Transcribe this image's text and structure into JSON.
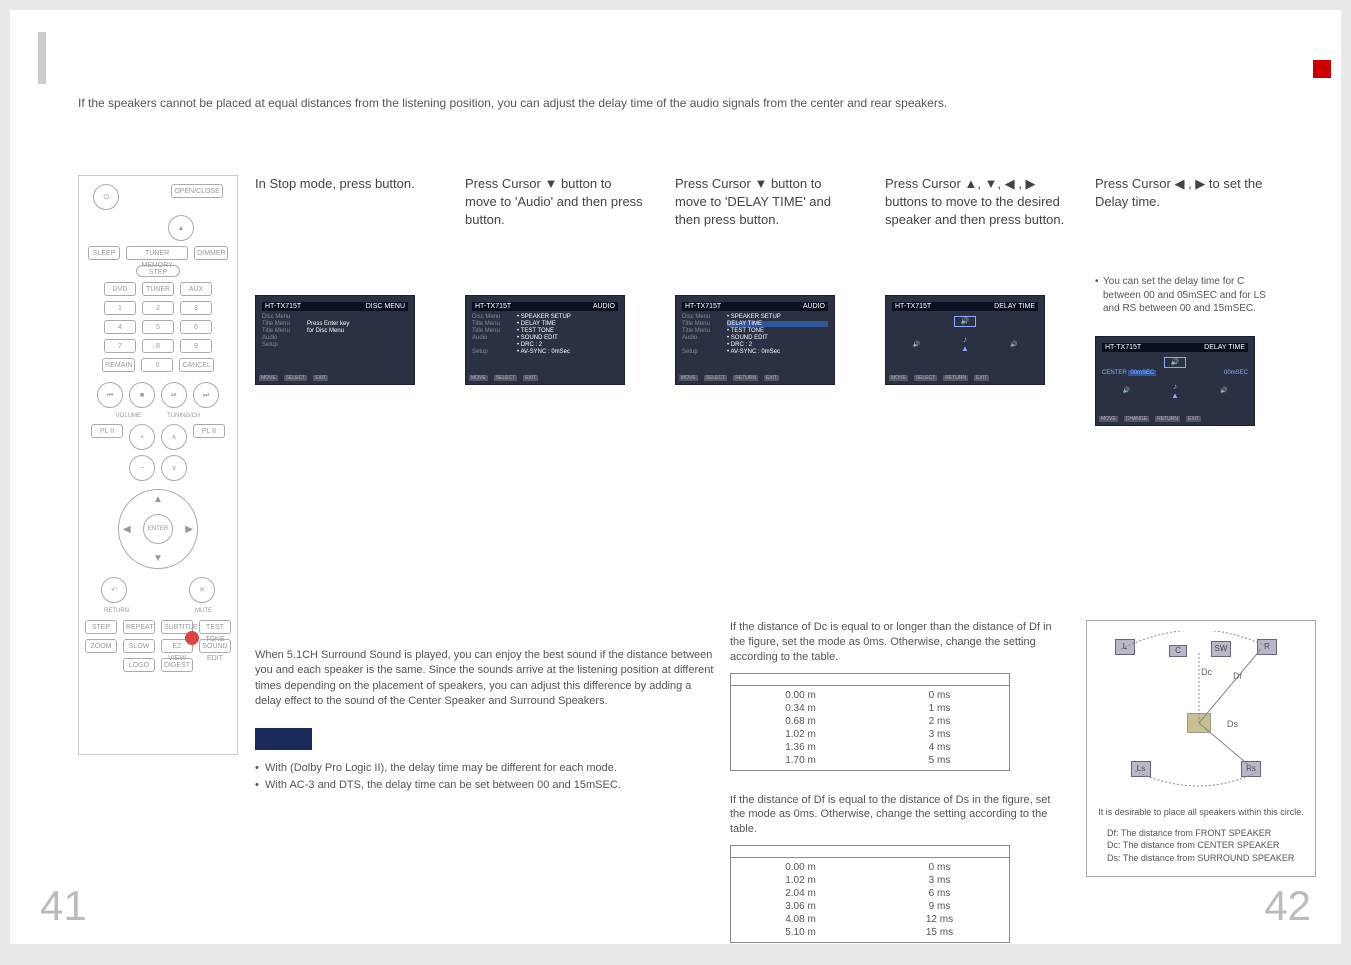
{
  "intro": "If the speakers cannot be placed at equal distances from the listening position, you can adjust the delay time of\nthe audio signals from the center and rear speakers.",
  "steps": [
    {
      "text_pre": "In Stop mode, press",
      "text_post": "button.",
      "screen_title": "DISC MENU",
      "line1": "Press Enter key",
      "line2": "for Disc Menu"
    },
    {
      "text_pre": "Press Cursor ▼ button to move to 'Audio' and then press",
      "text_post": "button.",
      "screen_title": "AUDIO",
      "rows": [
        "SPEAKER SETUP",
        "DELAY TIME",
        "TEST TONE",
        "SOUND EDIT",
        "DRC     : 2",
        "AV-SYNC  : 0mSec"
      ]
    },
    {
      "text_pre": "Press Cursor ▼ button to move to 'DELAY TIME' and then press",
      "text_post": "button.",
      "screen_title": "AUDIO",
      "rows": [
        "SPEAKER SETUP",
        "DELAY TIME",
        "TEST TONE",
        "SOUND EDIT",
        "DRC     : 2",
        "AV-SYNC  : 0mSec"
      ],
      "highlight": 1
    },
    {
      "text_pre": "Press Cursor ▲, ▼, ◀ , ▶ buttons to move to the desired speaker and then press",
      "text_post": "button.",
      "screen_title": "DELAY TIME"
    },
    {
      "text_pre": "Press Cursor ◀ , ▶ to set the Delay time.",
      "text_post": "",
      "screen_title": "DELAY TIME",
      "tip": "You can set the delay time for C between 00 and 05mSEC and for LS and RS between 00 and 15mSEC."
    }
  ],
  "screen_sidebar": [
    "Disc Menu",
    "Title Menu",
    "Title Menu",
    "Audio",
    "Setup"
  ],
  "screen_footer": [
    "MOVE",
    "SELECT",
    "RETURN",
    "EXIT"
  ],
  "surround_para": "When 5.1CH Surround Sound is played, you can enjoy the best sound if the distance between you and each speaker is the same. Since the sounds arrive at the listening position at different times depending on the placement of speakers, you can adjust this difference by adding a delay effect to the sound of the Center Speaker and Surround Speakers.",
  "note_bullets": [
    "With           (Dolby Pro Logic II), the delay time may be different for each mode.",
    "With AC-3 and DTS, the delay time can be set between 00 and 15mSEC."
  ],
  "center_intro": "If the distance of Dc is equal to or longer than the distance of Df in the figure, set the mode as 0ms. Otherwise, change the setting according to the table.",
  "rear_intro": "If the distance of Df is equal to the distance of Ds in the figure, set the mode as 0ms. Otherwise, change the setting according to the table.",
  "center_table": [
    [
      "0.00 m",
      "0 ms"
    ],
    [
      "0.34 m",
      "1 ms"
    ],
    [
      "0.68 m",
      "2 ms"
    ],
    [
      "1.02 m",
      "3 ms"
    ],
    [
      "1.36 m",
      "4 ms"
    ],
    [
      "1.70 m",
      "5 ms"
    ]
  ],
  "rear_table": [
    [
      "0.00 m",
      "0 ms"
    ],
    [
      "1.02 m",
      "3 ms"
    ],
    [
      "2.04 m",
      "6 ms"
    ],
    [
      "3.06 m",
      "9 ms"
    ],
    [
      "4.08 m",
      "12 ms"
    ],
    [
      "5.10 m",
      "15 ms"
    ]
  ],
  "diagram": {
    "L": "L",
    "C": "C",
    "SW": "SW",
    "R": "R",
    "Ls": "Ls",
    "Rs": "Rs",
    "Dc": "Dc",
    "Df": "Df",
    "Ds": "Ds"
  },
  "diagram_caption": "It is desirable to place all speakers within this circle.",
  "diagram_legend": [
    "Df: The distance from FRONT SPEAKER",
    "Dc: The distance from CENTER SPEAKER",
    "Ds: The distance from SURROUND SPEAKER"
  ],
  "remote": {
    "row1": [
      "",
      "OPEN/CLOSE"
    ],
    "top": [
      "",
      "▲"
    ],
    "row2": [
      "SLEEP",
      "TUNER MEMORY",
      "DIMMER"
    ],
    "row3": [
      "DVD",
      "TUNER",
      "AUX"
    ],
    "nums": [
      [
        "1",
        "2",
        "3"
      ],
      [
        "4",
        "5",
        "6"
      ],
      [
        "7",
        "8",
        "9"
      ],
      [
        "REMAIN",
        "0",
        "CANCEL"
      ]
    ],
    "transport": [
      "⏮",
      "■",
      "⏯",
      "⏭"
    ],
    "vol": [
      "VOLUME",
      "TUNING/CH"
    ],
    "pl": [
      "PL II",
      "+",
      "",
      "PL II"
    ],
    "enter": "ENTER",
    "return": "RETURN",
    "mute": "MUTE",
    "bottom": [
      [
        "STEP",
        "REPEAT",
        "SUBTITLE",
        "TEST TONE"
      ],
      [
        "ZOOM",
        "SLOW",
        "EZ VIEW",
        "SOUND EDIT"
      ],
      [
        "LOGO",
        "DIGEST",
        "",
        ""
      ]
    ]
  },
  "delay_screen": {
    "center": "00mSEC",
    "rear": "00mSEC"
  },
  "page_left": "41",
  "page_right": "42"
}
